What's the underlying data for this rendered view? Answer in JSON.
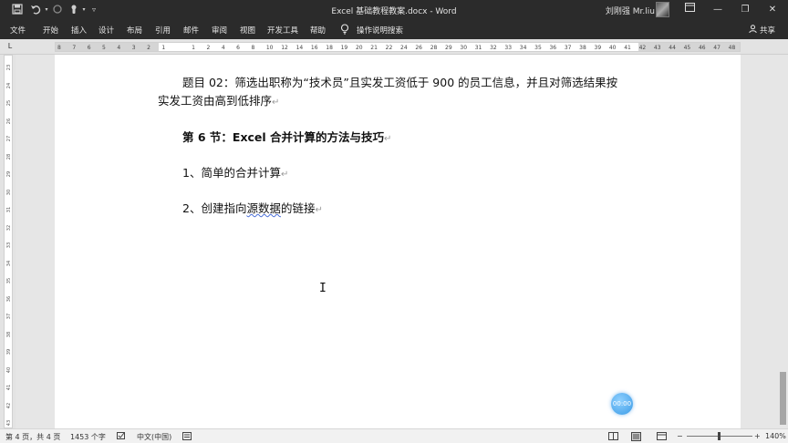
{
  "titlebar": {
    "document_title": "Excel 基础教程教案.docx - Word",
    "user_name": "刘刚强 Mr.liu",
    "quick_access": {
      "save_icon": "save-icon",
      "undo_icon": "undo-icon",
      "redo_icon": "redo-icon",
      "touch_icon": "touch-mode-icon",
      "customize_icon": "customize-icon"
    },
    "window_buttons": {
      "ribbon_display_icon": "ribbon-display-icon",
      "minimize": "—",
      "restore": "❐",
      "close": "✕"
    }
  },
  "menu": {
    "tabs": [
      "文件",
      "开始",
      "插入",
      "设计",
      "布局",
      "引用",
      "邮件",
      "审阅",
      "视图",
      "开发工具",
      "帮助"
    ],
    "tell_me": "操作说明搜索",
    "share": "共享"
  },
  "ruler": {
    "tab_selector": "L",
    "horizontal_labels": [
      "8",
      "7",
      "6",
      "5",
      "4",
      "3",
      "2",
      "1",
      "",
      "1",
      "2",
      "4",
      "6",
      "8",
      "10",
      "12",
      "14",
      "16",
      "18",
      "19",
      "20",
      "21",
      "22",
      "24",
      "26",
      "28",
      "29",
      "30",
      "31",
      "32",
      "33",
      "34",
      "35",
      "36",
      "37",
      "38",
      "39",
      "40",
      "41",
      "42",
      "43",
      "44",
      "45",
      "46",
      "47",
      "48"
    ],
    "vertical_labels": [
      "23",
      "24",
      "25",
      "26",
      "27",
      "28",
      "29",
      "30",
      "31",
      "32",
      "33",
      "34",
      "35",
      "36",
      "37",
      "38",
      "39",
      "40",
      "41",
      "42",
      "43"
    ]
  },
  "document": {
    "paragraphs": [
      {
        "text": "题目 02：筛选出职称为“技术员”且实发工资低于 900 的员工信息，并且对筛选结果按"
      },
      {
        "text": "实发工资由高到低排序"
      },
      {
        "text": "第 6 节：Excel 合并计算的方法与技巧"
      },
      {
        "text": "1、简单的合并计算"
      },
      {
        "text_before": "2、创建指向",
        "text_squiggle": "源数据",
        "text_after": "的链接"
      }
    ],
    "paragraph_mark": "↵"
  },
  "timer": "00:00",
  "statusbar": {
    "page": "第 4 页，共 4 页",
    "word_count": "1453 个字",
    "language": "中文(中国)",
    "zoom": "140%"
  }
}
